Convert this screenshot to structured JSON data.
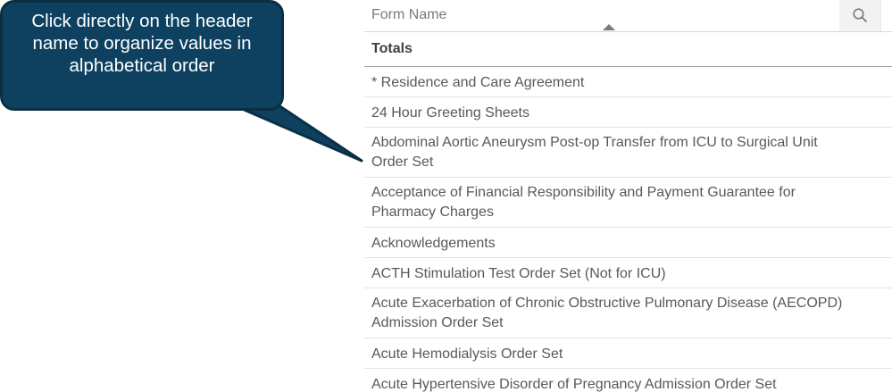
{
  "callout": {
    "text": "Click directly on the header name to organize values in alphabetical order"
  },
  "table": {
    "header_label": "Form Name",
    "sort_direction": "ascending",
    "search_icon": "search-icon",
    "totals_label": "Totals",
    "rows": [
      "* Residence and Care Agreement",
      "24 Hour Greeting Sheets",
      "Abdominal Aortic Aneurysm Post-op Transfer from ICU to Surgical Unit Order Set",
      "Acceptance of Financial Responsibility and Payment Guarantee for Pharmacy Charges",
      "Acknowledgements",
      "ACTH Stimulation Test Order Set (Not for ICU)",
      "Acute Exacerbation of Chronic Obstructive Pulmonary Disease (AECOPD) Admission Order Set",
      "Acute Hemodialysis Order Set",
      "Acute Hypertensive Disorder of Pregnancy Admission Order Set"
    ]
  },
  "colors": {
    "callout_fill": "#0e4160",
    "callout_border": "#0a2f45",
    "text": "#595959"
  }
}
